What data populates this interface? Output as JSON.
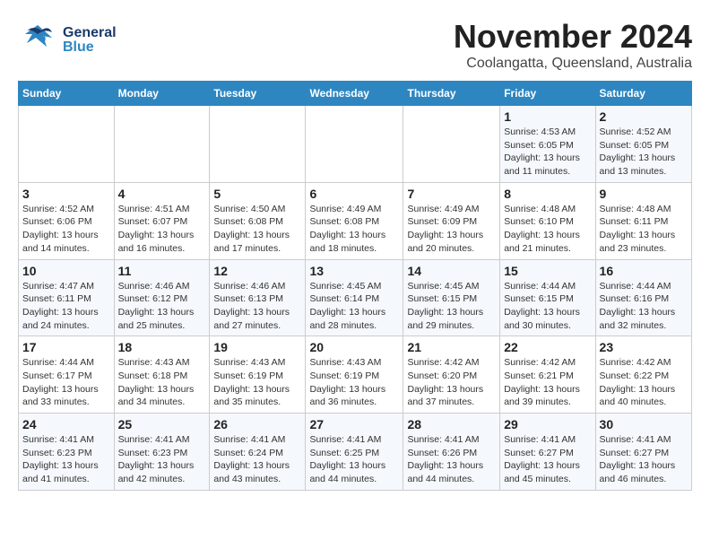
{
  "header": {
    "logo_general": "General",
    "logo_blue": "Blue",
    "month_title": "November 2024",
    "location": "Coolangatta, Queensland, Australia"
  },
  "calendar": {
    "days_of_week": [
      "Sunday",
      "Monday",
      "Tuesday",
      "Wednesday",
      "Thursday",
      "Friday",
      "Saturday"
    ],
    "weeks": [
      [
        {
          "day": "",
          "info": ""
        },
        {
          "day": "",
          "info": ""
        },
        {
          "day": "",
          "info": ""
        },
        {
          "day": "",
          "info": ""
        },
        {
          "day": "",
          "info": ""
        },
        {
          "day": "1",
          "info": "Sunrise: 4:53 AM\nSunset: 6:05 PM\nDaylight: 13 hours and 11 minutes."
        },
        {
          "day": "2",
          "info": "Sunrise: 4:52 AM\nSunset: 6:05 PM\nDaylight: 13 hours and 13 minutes."
        }
      ],
      [
        {
          "day": "3",
          "info": "Sunrise: 4:52 AM\nSunset: 6:06 PM\nDaylight: 13 hours and 14 minutes."
        },
        {
          "day": "4",
          "info": "Sunrise: 4:51 AM\nSunset: 6:07 PM\nDaylight: 13 hours and 16 minutes."
        },
        {
          "day": "5",
          "info": "Sunrise: 4:50 AM\nSunset: 6:08 PM\nDaylight: 13 hours and 17 minutes."
        },
        {
          "day": "6",
          "info": "Sunrise: 4:49 AM\nSunset: 6:08 PM\nDaylight: 13 hours and 18 minutes."
        },
        {
          "day": "7",
          "info": "Sunrise: 4:49 AM\nSunset: 6:09 PM\nDaylight: 13 hours and 20 minutes."
        },
        {
          "day": "8",
          "info": "Sunrise: 4:48 AM\nSunset: 6:10 PM\nDaylight: 13 hours and 21 minutes."
        },
        {
          "day": "9",
          "info": "Sunrise: 4:48 AM\nSunset: 6:11 PM\nDaylight: 13 hours and 23 minutes."
        }
      ],
      [
        {
          "day": "10",
          "info": "Sunrise: 4:47 AM\nSunset: 6:11 PM\nDaylight: 13 hours and 24 minutes."
        },
        {
          "day": "11",
          "info": "Sunrise: 4:46 AM\nSunset: 6:12 PM\nDaylight: 13 hours and 25 minutes."
        },
        {
          "day": "12",
          "info": "Sunrise: 4:46 AM\nSunset: 6:13 PM\nDaylight: 13 hours and 27 minutes."
        },
        {
          "day": "13",
          "info": "Sunrise: 4:45 AM\nSunset: 6:14 PM\nDaylight: 13 hours and 28 minutes."
        },
        {
          "day": "14",
          "info": "Sunrise: 4:45 AM\nSunset: 6:15 PM\nDaylight: 13 hours and 29 minutes."
        },
        {
          "day": "15",
          "info": "Sunrise: 4:44 AM\nSunset: 6:15 PM\nDaylight: 13 hours and 30 minutes."
        },
        {
          "day": "16",
          "info": "Sunrise: 4:44 AM\nSunset: 6:16 PM\nDaylight: 13 hours and 32 minutes."
        }
      ],
      [
        {
          "day": "17",
          "info": "Sunrise: 4:44 AM\nSunset: 6:17 PM\nDaylight: 13 hours and 33 minutes."
        },
        {
          "day": "18",
          "info": "Sunrise: 4:43 AM\nSunset: 6:18 PM\nDaylight: 13 hours and 34 minutes."
        },
        {
          "day": "19",
          "info": "Sunrise: 4:43 AM\nSunset: 6:19 PM\nDaylight: 13 hours and 35 minutes."
        },
        {
          "day": "20",
          "info": "Sunrise: 4:43 AM\nSunset: 6:19 PM\nDaylight: 13 hours and 36 minutes."
        },
        {
          "day": "21",
          "info": "Sunrise: 4:42 AM\nSunset: 6:20 PM\nDaylight: 13 hours and 37 minutes."
        },
        {
          "day": "22",
          "info": "Sunrise: 4:42 AM\nSunset: 6:21 PM\nDaylight: 13 hours and 39 minutes."
        },
        {
          "day": "23",
          "info": "Sunrise: 4:42 AM\nSunset: 6:22 PM\nDaylight: 13 hours and 40 minutes."
        }
      ],
      [
        {
          "day": "24",
          "info": "Sunrise: 4:41 AM\nSunset: 6:23 PM\nDaylight: 13 hours and 41 minutes."
        },
        {
          "day": "25",
          "info": "Sunrise: 4:41 AM\nSunset: 6:23 PM\nDaylight: 13 hours and 42 minutes."
        },
        {
          "day": "26",
          "info": "Sunrise: 4:41 AM\nSunset: 6:24 PM\nDaylight: 13 hours and 43 minutes."
        },
        {
          "day": "27",
          "info": "Sunrise: 4:41 AM\nSunset: 6:25 PM\nDaylight: 13 hours and 44 minutes."
        },
        {
          "day": "28",
          "info": "Sunrise: 4:41 AM\nSunset: 6:26 PM\nDaylight: 13 hours and 44 minutes."
        },
        {
          "day": "29",
          "info": "Sunrise: 4:41 AM\nSunset: 6:27 PM\nDaylight: 13 hours and 45 minutes."
        },
        {
          "day": "30",
          "info": "Sunrise: 4:41 AM\nSunset: 6:27 PM\nDaylight: 13 hours and 46 minutes."
        }
      ]
    ]
  }
}
